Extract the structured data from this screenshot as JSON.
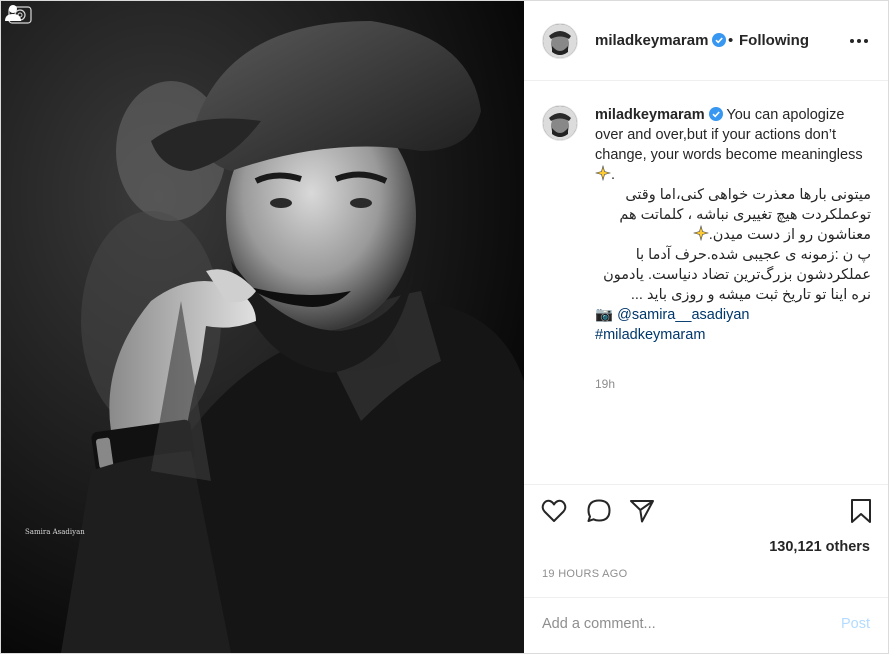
{
  "post": {
    "username": "miladkeymaram",
    "follow_status": "Following",
    "dot": "•",
    "caption_en": "You can apologize over and over,but if your actions don’t change, your words become meaningless",
    "caption_fa_1": "میتونی بارها معذرت خواهی کنی،اما وقتی توعملکردت هیچ تغییری نباشه ، کلماتت هم معناشون رو از دست میدن.",
    "caption_fa_2": "پ ن :زمونه ی عجیبی شده.حرف آدما با عملکردشون بزرگ‌ترین تضاد دنیاست. یادمون نره اینا تو تاریخ ثبت میشه و روزی باید ...",
    "credit_emoji": "📷",
    "credit_mention": "@samira__asadiyan",
    "hashtag": "#miladkeymaram",
    "relative_time": "19h",
    "likes": "130,121 others",
    "timestamp": "19 HOURS AGO",
    "comment_placeholder": "Add a comment...",
    "post_button": "Post",
    "watermark": "Samira Asadiyan"
  },
  "icons": {
    "like": "heart-icon",
    "comment": "comment-icon",
    "share": "share-icon",
    "save": "bookmark-icon",
    "more": "more-icon",
    "verified": "verified-badge-icon",
    "tag": "user-tag-icon"
  },
  "colors": {
    "verified": "#3897f0",
    "link": "#00376b",
    "muted": "#8e8e8e",
    "post_disabled": "#b3dbff"
  }
}
